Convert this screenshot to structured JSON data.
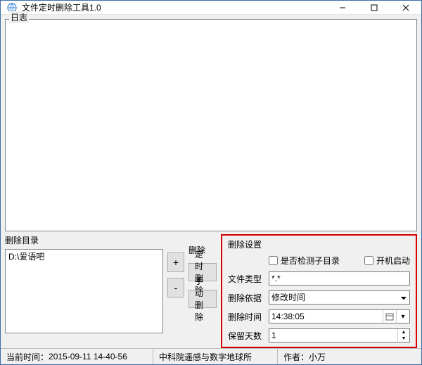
{
  "title": "文件定时删除工具1.0",
  "log": {
    "label": "日志"
  },
  "dirs": {
    "label": "删除目录",
    "items": [
      "D:\\爱语吧"
    ]
  },
  "pm": {
    "plus": "+",
    "minus": "-"
  },
  "del": {
    "label": "删除",
    "timed": "定时删除",
    "manual": "手动删除"
  },
  "settings": {
    "title": "删除设置",
    "check_subdir": "是否检测子目录",
    "autostart": "开机启动",
    "file_type_label": "文件类型",
    "file_type_value": "*.*",
    "basis_label": "删除依据",
    "basis_value": "修改时间",
    "time_label": "删除时间",
    "time_value": "14:38:05",
    "keep_label": "保留天数",
    "keep_value": "1"
  },
  "status": {
    "now_label": "当前时间：",
    "now_value": "2015-09-11 14-40-56",
    "org": "中科院遥感与数字地球所",
    "author_label": "作者：",
    "author_value": "小万"
  }
}
